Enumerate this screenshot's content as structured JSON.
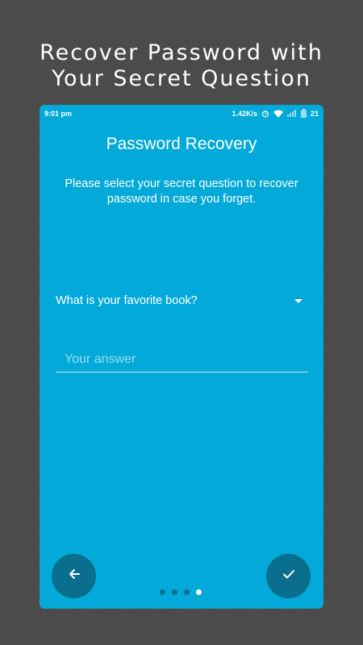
{
  "headline": {
    "line1": "Recover Password with",
    "line2": "Your Secret Question"
  },
  "status_bar": {
    "time": "9:01 pm",
    "network_speed": "1.42K/s",
    "battery": "21",
    "icons": [
      "alarm-icon",
      "wifi-icon",
      "signal-icon",
      "battery-icon"
    ]
  },
  "screen": {
    "title": "Password Recovery",
    "description": "Please select your secret question to recover password in case you forget.",
    "question_selected": "What is your favorite book?",
    "answer_placeholder": "Your answer",
    "answer_value": "",
    "pager": {
      "total": 4,
      "active_index": 3
    },
    "back_icon": "arrow-left-icon",
    "done_icon": "check-icon"
  },
  "colors": {
    "background": "#4a4a4a",
    "primary": "#03a9d8",
    "accent_dark": "#0a6e8d",
    "text": "#ffffff"
  }
}
